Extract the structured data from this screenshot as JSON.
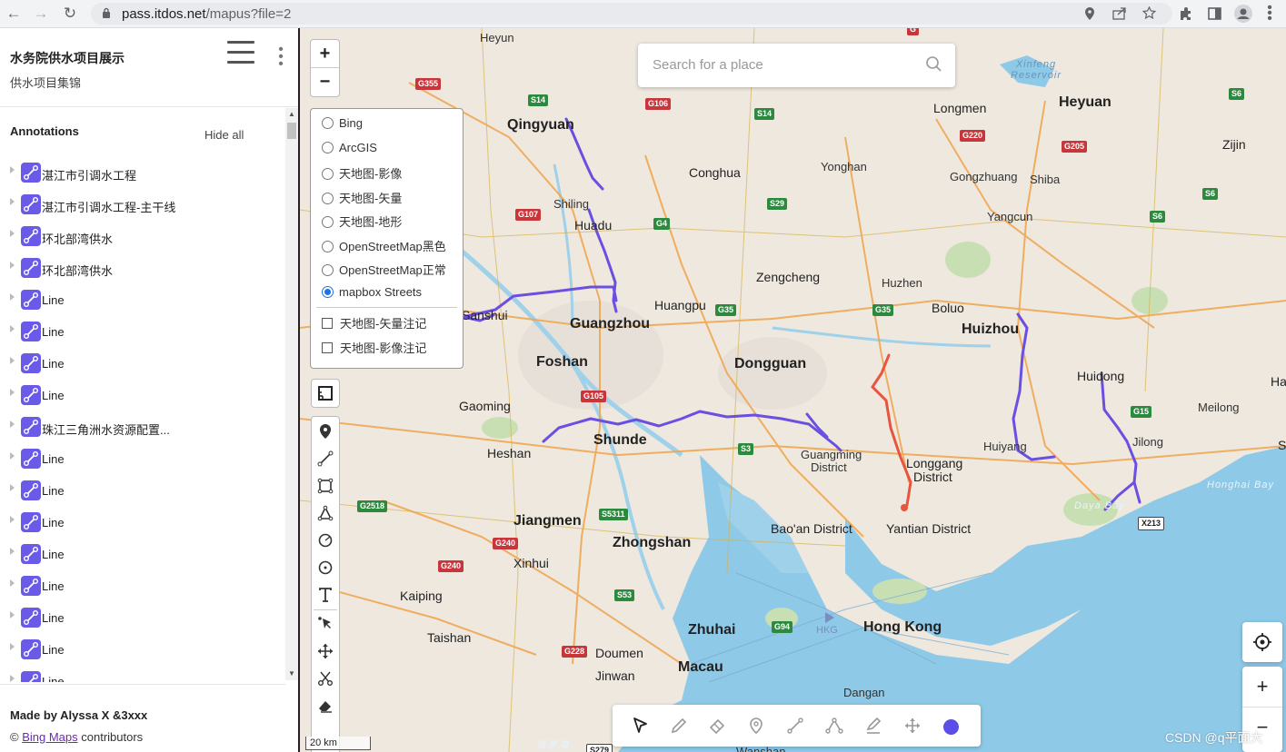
{
  "browser": {
    "url_host": "pass.itdos.net",
    "url_path": "/mapus?file=2"
  },
  "sidebar": {
    "title": "水务院供水项目展示",
    "subtitle": "供水项目集锦",
    "annotations_heading": "Annotations",
    "hide_all": "Hide all",
    "items": [
      {
        "label": "湛江市引调水工程"
      },
      {
        "label": "湛江市引调水工程-主干线"
      },
      {
        "label": "环北部湾供水"
      },
      {
        "label": "环北部湾供水"
      },
      {
        "label": "Line"
      },
      {
        "label": "Line"
      },
      {
        "label": "Line"
      },
      {
        "label": "Line"
      },
      {
        "label": "珠江三角洲水资源配置..."
      },
      {
        "label": "Line"
      },
      {
        "label": "Line"
      },
      {
        "label": "Line"
      },
      {
        "label": "Line"
      },
      {
        "label": "Line"
      },
      {
        "label": "Line"
      },
      {
        "label": "Line"
      },
      {
        "label": "Line"
      }
    ],
    "made_by": "Made by Alyssa X &3xxx",
    "attrib_prefix": "©",
    "attrib_link": "Bing Maps",
    "attrib_suffix": "contributors"
  },
  "map": {
    "search_placeholder": "Search for a place",
    "zoom_in": "+",
    "zoom_out": "−",
    "layers": [
      {
        "label": "Bing",
        "selected": false
      },
      {
        "label": "ArcGIS",
        "selected": false
      },
      {
        "label": "天地图-影像",
        "selected": false
      },
      {
        "label": "天地图-矢量",
        "selected": false
      },
      {
        "label": "天地图-地形",
        "selected": false
      },
      {
        "label": "OpenStreetMap黑色",
        "selected": false
      },
      {
        "label": "OpenStreetMap正常",
        "selected": false
      },
      {
        "label": "mapbox Streets",
        "selected": true
      }
    ],
    "overlays": [
      {
        "label": "天地图-矢量注记",
        "checked": false
      },
      {
        "label": "天地图-影像注记",
        "checked": false
      }
    ],
    "scale": "20 km",
    "zoom2_in": "+",
    "zoom2_out": "−",
    "watermark": "CSDN @q平面大",
    "draw_color": "#5b4de8",
    "places": {
      "heyun": "Heyun",
      "qingyuan": "Qingyuan",
      "shiling": "Shiling",
      "huadu": "Huadu",
      "conghua": "Conghua",
      "yonghan": "Yonghan",
      "longmen": "Longmen",
      "heyuan": "Heyuan",
      "zijin": "Zijin",
      "gongzhuang": "Gongzhuang",
      "shiba": "Shiba",
      "yangcun": "Yangcun",
      "zengcheng": "Zengcheng",
      "huzhen": "Huzhen",
      "boluo": "Boluo",
      "huizhou": "Huizhou",
      "huangpu": "Huangpu",
      "sanshui": "Sanshui",
      "guangzhou": "Guangzhou",
      "foshan": "Foshan",
      "dongguan": "Dongguan",
      "huidong": "Huidong",
      "meilong": "Meilong",
      "gaoming": "Gaoming",
      "shunde": "Shunde",
      "heshan": "Heshan",
      "guangming": "Guangming",
      "district1": "District",
      "huiyang": "Huiyang",
      "jilong": "Jilong",
      "longgang": "Longgang",
      "district2": "District",
      "jiangmen": "Jiangmen",
      "zhongshan": "Zhongshan",
      "baoan": "Bao'an District",
      "yantian": "Yantian District",
      "xinhui": "Xinhui",
      "kaiping": "Kaiping",
      "taishan": "Taishan",
      "zhuhai": "Zhuhai",
      "hongkong": "Hong Kong",
      "doumen": "Doumen",
      "macau": "Macau",
      "jinwan": "Jinwan",
      "dangan": "Dangan",
      "wanshan": "Wanshan",
      "hkg": "HKG",
      "reservoir": "Xinfeng Reservoir",
      "honghai": "Honghai Bay",
      "dayabay": "Daya Bay",
      "hai": "Hai",
      "s": "S",
      "huangmao": "黄茅海"
    },
    "shields": {
      "g355": "G355",
      "s14a": "S14",
      "g106": "G106",
      "s14b": "S14",
      "g220": "G220",
      "g205": "G205",
      "s6a": "S6",
      "s6b": "S6",
      "s6c": "S6",
      "g107": "G107",
      "g4": "G4",
      "s29": "S29",
      "g35a": "G35",
      "g35b": "G35",
      "g105": "G105",
      "s3": "S3",
      "g15": "G15",
      "g2518": "G2518",
      "s5311": "S5311",
      "g240a": "G240",
      "g240b": "G240",
      "s53": "S53",
      "g94": "G94",
      "g228": "G228",
      "x213": "X213",
      "s279": "S279",
      "g0": "G"
    }
  }
}
